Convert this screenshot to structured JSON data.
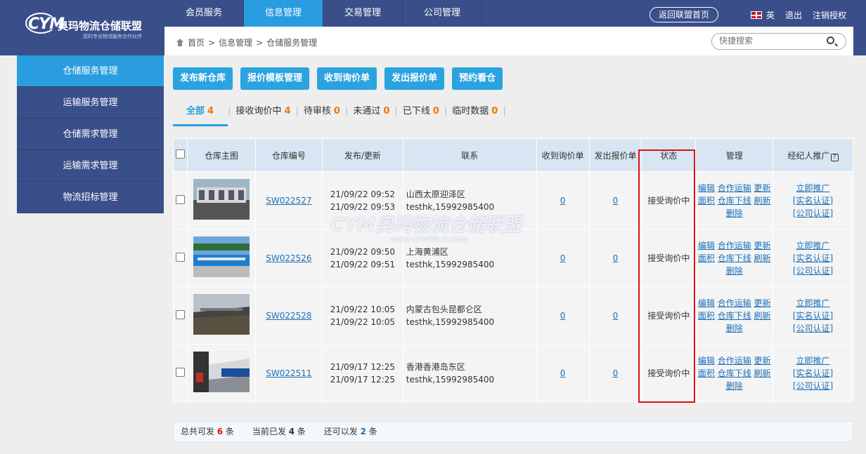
{
  "logo": {
    "brand_mark": "CYM",
    "name": "奥玛物流仓储联盟",
    "slogan": "您的专业物流服务合作伙伴"
  },
  "nav": {
    "items": [
      {
        "label": "会员服务"
      },
      {
        "label": "信息管理"
      },
      {
        "label": "交易管理"
      },
      {
        "label": "公司管理"
      }
    ],
    "active_index": 1,
    "back_label": "返回联盟首页",
    "lang_label": "英",
    "logout_label": "退出",
    "cancel_auth_label": "注销授权"
  },
  "breadcrumb": {
    "home": "首页",
    "sep": ">",
    "level1": "信息管理",
    "level2": "仓储服务管理"
  },
  "search": {
    "placeholder": "快捷搜索"
  },
  "sidebar": {
    "items": [
      {
        "label": "仓储服务管理"
      },
      {
        "label": "运输服务管理"
      },
      {
        "label": "仓储需求管理"
      },
      {
        "label": "运输需求管理"
      },
      {
        "label": "物流招标管理"
      }
    ]
  },
  "actions": {
    "publish": "发布新仓库",
    "template": "报价模板管理",
    "inquiries": "收到询价单",
    "quotes": "发出报价单",
    "visit": "预约看仓"
  },
  "tabs": [
    {
      "label": "全部",
      "count": "4"
    },
    {
      "label": "接收询价中",
      "count": "4"
    },
    {
      "label": "待审核",
      "count": "0"
    },
    {
      "label": "未通过",
      "count": "0"
    },
    {
      "label": "已下线",
      "count": "0"
    },
    {
      "label": "临时数据",
      "count": "0"
    }
  ],
  "table": {
    "headers": {
      "image": "仓库主图",
      "code": "仓库编号",
      "time": "发布/更新",
      "contact": "联系",
      "inquiries": "收到询价单",
      "quotes": "发出报价单",
      "status": "状态",
      "manage": "管理",
      "agent": "经纪人推广",
      "help": "?"
    },
    "actions": {
      "edit": "编辑",
      "coop": "合作运输",
      "update": "更新",
      "area": "面积",
      "offline": "仓库下线",
      "refresh": "刷新",
      "delete": "删除",
      "promote": "立即推广",
      "realname": "[实名认证]",
      "company": "[公司认证]"
    },
    "rows": [
      {
        "code": "SW022527",
        "published": "21/09/22 09:52",
        "updated": "21/09/22 09:53",
        "location": "山西太原迎泽区",
        "contact": "testhk,15992985400",
        "inquiries": "0",
        "quotes": "0",
        "status": "接受询价中"
      },
      {
        "code": "SW022526",
        "published": "21/09/22 09:50",
        "updated": "21/09/22 09:51",
        "location": "上海黄浦区",
        "contact": "testhk,15992985400",
        "inquiries": "0",
        "quotes": "0",
        "status": "接受询价中"
      },
      {
        "code": "SW022528",
        "published": "21/09/22 10:05",
        "updated": "21/09/22 10:05",
        "location": "内蒙古包头昆都仑区",
        "contact": "testhk,15992985400",
        "inquiries": "0",
        "quotes": "0",
        "status": "接受询价中"
      },
      {
        "code": "SW022511",
        "published": "21/09/17 12:25",
        "updated": "21/09/17 12:25",
        "location": "香港香港岛东区",
        "contact": "testhk,15992985400",
        "inquiries": "0",
        "quotes": "0",
        "status": "接受询价中"
      }
    ]
  },
  "watermark": {
    "title": "CYM奥玛物流仓储联盟",
    "url": "www.cym56Lm.com"
  },
  "footer": {
    "total_label": "总共可发",
    "total": "6",
    "unit": "条",
    "current_label": "当前已发",
    "current": "4",
    "remaining_label": "还可以发",
    "remaining": "2"
  },
  "colors": {
    "nav_bg": "#3a4f8a",
    "accent": "#2a9de0",
    "count": "#f07800",
    "highlight_box": "#e01010"
  }
}
